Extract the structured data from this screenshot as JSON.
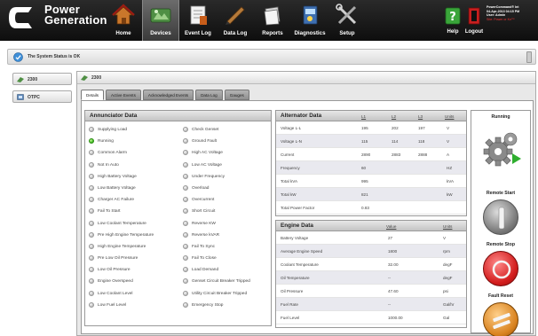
{
  "brand": {
    "line1": "Power",
    "line2": "Generation",
    "logo_icon": "cummins-c-logo-icon"
  },
  "nav": [
    {
      "label": "Home",
      "icon": "house-icon"
    },
    {
      "label": "Devices",
      "icon": "devices-icon",
      "active": true
    },
    {
      "label": "Event Log",
      "icon": "event-log-icon"
    },
    {
      "label": "Data Log",
      "icon": "data-log-icon"
    },
    {
      "label": "Reports",
      "icon": "reports-icon"
    },
    {
      "label": "Diagnostics",
      "icon": "diagnostics-icon"
    },
    {
      "label": "Setup",
      "icon": "setup-tools-icon"
    }
  ],
  "utility": {
    "help_label": "Help",
    "logout_label": "Logout"
  },
  "user": {
    "product": "PowerCommand® Int",
    "date": "04-Apr-2013 04:15 PM",
    "user": "User: Admin",
    "site": "Site: Power or Kn™"
  },
  "status": {
    "text": "The System Status is OK"
  },
  "sidebar": {
    "items": [
      {
        "label": "2300"
      },
      {
        "label": "OTPC"
      }
    ]
  },
  "panel": {
    "title": "2300"
  },
  "tabs": [
    "Details",
    "Active Events",
    "Acknowledged Events",
    "Data Log",
    "Gauges"
  ],
  "annunciator": {
    "title": "Annunciator Data",
    "left": [
      {
        "label": "Supplying Load",
        "on": false
      },
      {
        "label": "Running",
        "on": true
      },
      {
        "label": "Common Alarm",
        "on": false
      },
      {
        "label": "Not In Auto",
        "on": false
      },
      {
        "label": "High Battery Voltage",
        "on": false
      },
      {
        "label": "Low Battery Voltage",
        "on": false
      },
      {
        "label": "Charger AC Failure",
        "on": false
      },
      {
        "label": "Fail To Start",
        "on": false
      },
      {
        "label": "Low Coolant Temperature",
        "on": false
      },
      {
        "label": "Pre High Engine Temperature",
        "on": false
      },
      {
        "label": "High Engine Temperature",
        "on": false
      },
      {
        "label": "Pre Low Oil Pressure",
        "on": false
      },
      {
        "label": "Low Oil Pressure",
        "on": false
      },
      {
        "label": "Engine Overspeed",
        "on": false
      },
      {
        "label": "Low Coolant Level",
        "on": false
      },
      {
        "label": "Low Fuel Level",
        "on": false
      }
    ],
    "right": [
      {
        "label": "Check Genset",
        "on": false
      },
      {
        "label": "Ground Fault",
        "on": false
      },
      {
        "label": "High AC Voltage",
        "on": false
      },
      {
        "label": "Low AC Voltage",
        "on": false
      },
      {
        "label": "Under Frequency",
        "on": false
      },
      {
        "label": "Overload",
        "on": false
      },
      {
        "label": "Overcurrent",
        "on": false
      },
      {
        "label": "Short Circuit",
        "on": false
      },
      {
        "label": "Reverse KW",
        "on": false
      },
      {
        "label": "Reverse kVAR",
        "on": false
      },
      {
        "label": "Fail To Sync",
        "on": false
      },
      {
        "label": "Fail To Close",
        "on": false
      },
      {
        "label": "Load Demand",
        "on": false
      },
      {
        "label": "Genset Circuit Breaker Tripped",
        "on": false
      },
      {
        "label": "Utility Circuit Breaker Tripped",
        "on": false
      },
      {
        "label": "Emergency Stop",
        "on": false
      }
    ]
  },
  "alternator": {
    "title": "Alternator Data",
    "columns": [
      "L1",
      "L2",
      "L3",
      "Units"
    ],
    "rows": [
      {
        "label": "Voltage L-L",
        "l1": "195",
        "l2": "202",
        "l3": "197",
        "units": "V"
      },
      {
        "label": "Voltage L-N",
        "l1": "115",
        "l2": "114",
        "l3": "118",
        "units": "V"
      },
      {
        "label": "Current",
        "l1": "2890",
        "l2": "2883",
        "l3": "2888",
        "units": "A"
      },
      {
        "label": "Frequency",
        "l1": "60",
        "l2": "",
        "l3": "",
        "units": "HZ"
      },
      {
        "label": "Total kVA",
        "l1": "995",
        "l2": "",
        "l3": "",
        "units": "kVA"
      },
      {
        "label": "Total kW",
        "l1": "821",
        "l2": "",
        "l3": "",
        "units": "kW"
      },
      {
        "label": "Total Power Factor",
        "l1": "0.83",
        "l2": "",
        "l3": "",
        "units": ""
      }
    ]
  },
  "engine": {
    "title": "Engine Data",
    "columns": [
      "Value",
      "Units"
    ],
    "rows": [
      {
        "label": "Battery Voltage",
        "value": "27",
        "units": "V"
      },
      {
        "label": "Average Engine Speed",
        "value": "1800",
        "units": "rpm"
      },
      {
        "label": "Coolant Temperature",
        "value": "32.00",
        "units": "degF"
      },
      {
        "label": "Oil Temperature",
        "value": "--",
        "units": "degF"
      },
      {
        "label": "Oil Pressure",
        "value": "47.60",
        "units": "psi"
      },
      {
        "label": "Fuel Rate",
        "value": "--",
        "units": "Gal/hr"
      },
      {
        "label": "Fuel Level",
        "value": "1000.00",
        "units": "Gal"
      }
    ]
  },
  "controls": {
    "running_label": "Running",
    "remote_start_label": "Remote Start",
    "remote_stop_label": "Remote Stop",
    "fault_reset_label": "Fault Reset"
  }
}
